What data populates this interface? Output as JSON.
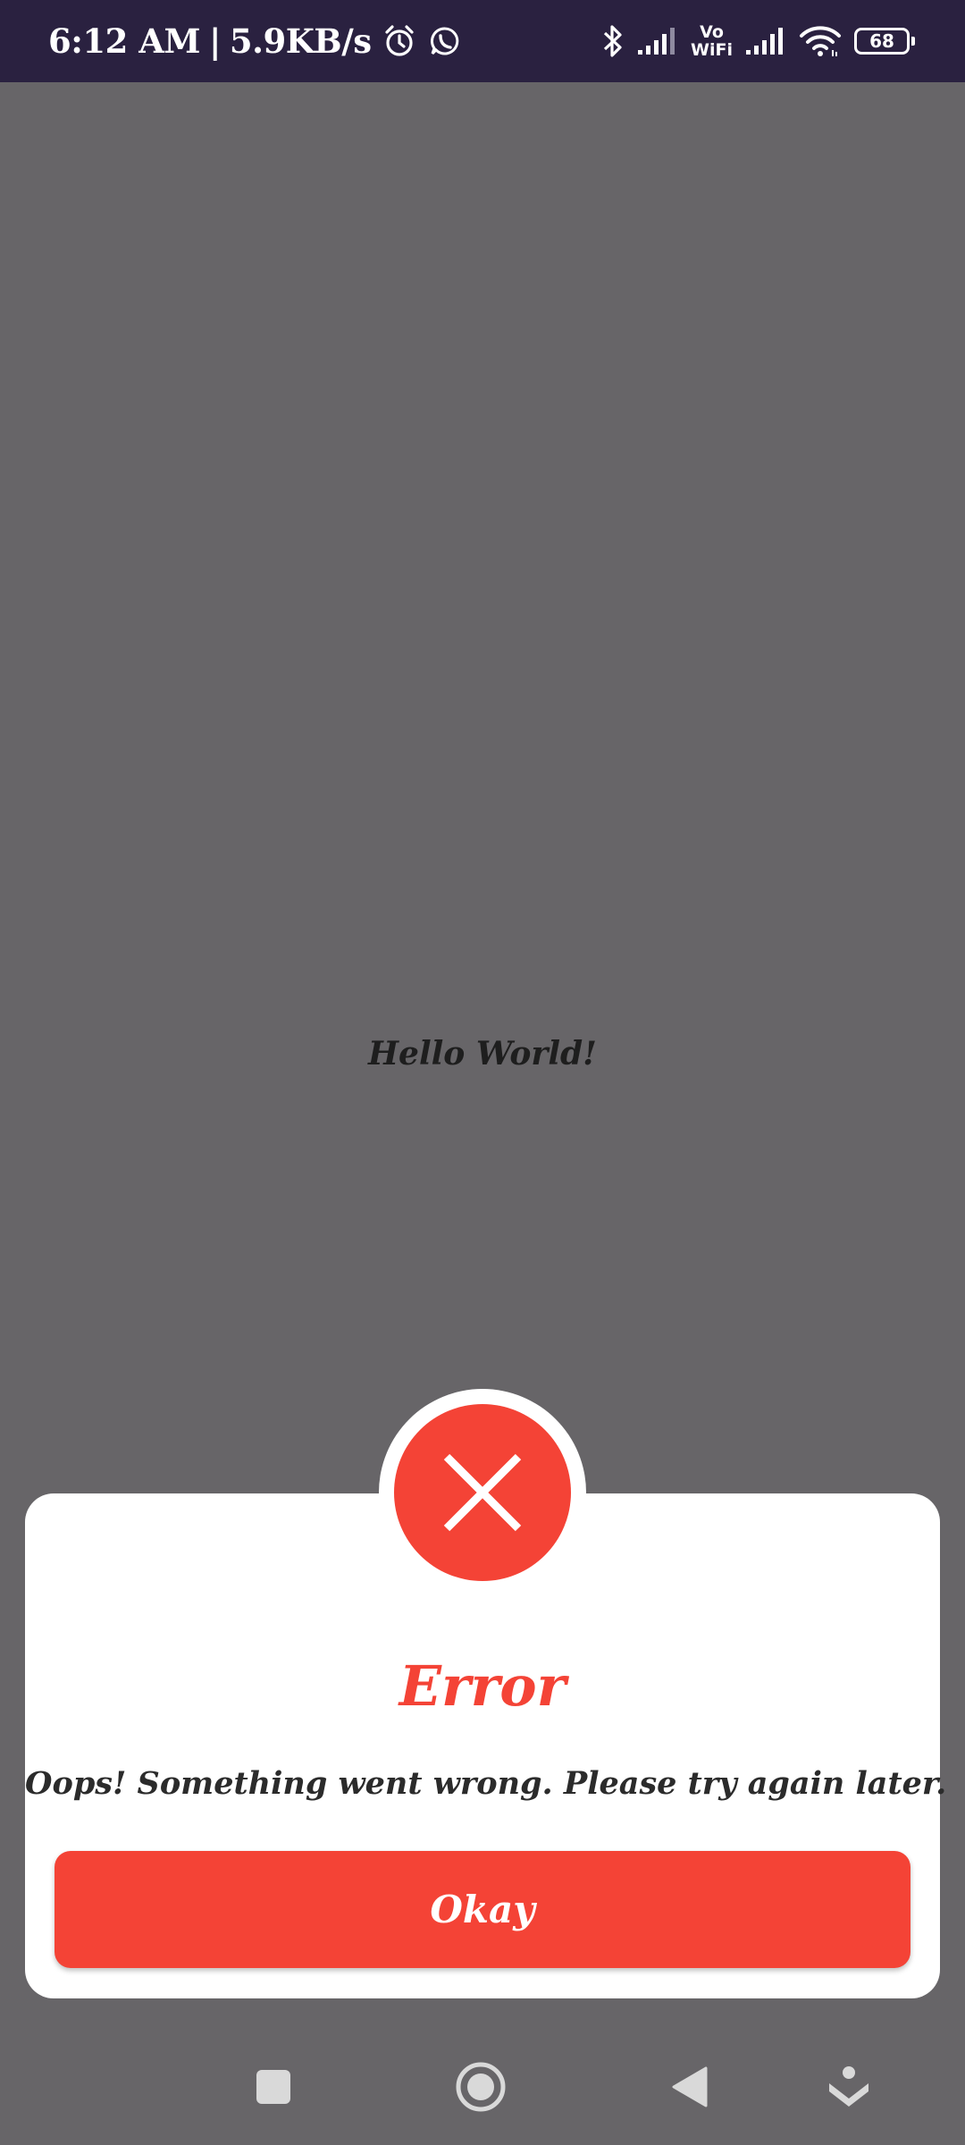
{
  "status_bar": {
    "time": "6:12 AM",
    "separator": "|",
    "speed": "5.9KB/s",
    "vowifi_top": "Vo",
    "vowifi_bottom": "WiFi",
    "battery": "68",
    "icons": [
      "alarm-icon",
      "whatsapp-icon",
      "bluetooth-icon",
      "signal-icon",
      "vowifi-icon",
      "signal-icon",
      "wifi-icon",
      "battery-icon"
    ]
  },
  "main": {
    "hello_text": "Hello World!"
  },
  "dialog": {
    "icon": "close-icon",
    "title": "Error",
    "message": "Oops! Something went wrong. Please try again later.",
    "button_label": "Okay"
  },
  "nav_bar": {
    "buttons": [
      "recents-icon",
      "home-icon",
      "back-icon",
      "assistant-icon"
    ]
  },
  "colors": {
    "status_bar_bg": "#2a2140",
    "overlay_bg": "#676568",
    "accent_red": "#f44336",
    "dialog_bg": "#ffffff"
  }
}
